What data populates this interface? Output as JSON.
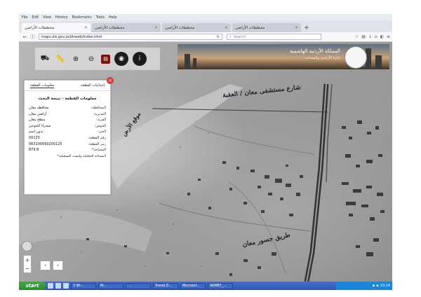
{
  "menubar": {
    "items": [
      "File",
      "Edit",
      "View",
      "History",
      "Bookmarks",
      "Tools",
      "Help"
    ]
  },
  "tabs": [
    {
      "label": "مخططات الأراضي",
      "active": true
    },
    {
      "label": "مخططات الأراضي",
      "active": false
    },
    {
      "label": "مخططات الأراضي",
      "active": false
    },
    {
      "label": "مخططات الأراضي",
      "active": false
    }
  ],
  "navbar": {
    "url": "maps.dls.gov.jo/dlsweb/index.html",
    "search_placeholder": "Search"
  },
  "banner": {
    "title": "المملكة الأردنية الهاشمية",
    "subtitle": "دائرة الأراضي والمساحة"
  },
  "panel": {
    "tabs": [
      "معلومات القطعة",
      "إحداثيات القطعة"
    ],
    "title": "معلومات القطعة - نتيجة البحث",
    "rows": [
      {
        "k": "المحافظة:",
        "v": "محافظة معان"
      },
      {
        "k": "المديرية:",
        "v": "أراضي معان"
      },
      {
        "k": "القرية:",
        "v": "سطح معان"
      },
      {
        "k": "الحوض:",
        "v": "صحراء الخوجي"
      },
      {
        "k": "الحي:",
        "v": "بدون اسم"
      },
      {
        "k": "رقم القطعة:",
        "v": "00125"
      },
      {
        "k": "رمز القطعة:",
        "v": "063100090200125"
      },
      {
        "k": "المساحة*:",
        "v": "879.8"
      }
    ],
    "note": "المساحة التحليلية وليست التسجيلية*"
  },
  "handwriting": {
    "top": "شارع مستشفى معان / العقبة",
    "left": "موقع الأرض",
    "bottom": "طريق جسور معان"
  },
  "taskbar": {
    "start": "start",
    "buttons": [
      "3 Wi...",
      "M...",
      "...",
      "Travel D...",
      "Microsof...",
      "SKMBT_..."
    ],
    "clock": "10:14"
  }
}
